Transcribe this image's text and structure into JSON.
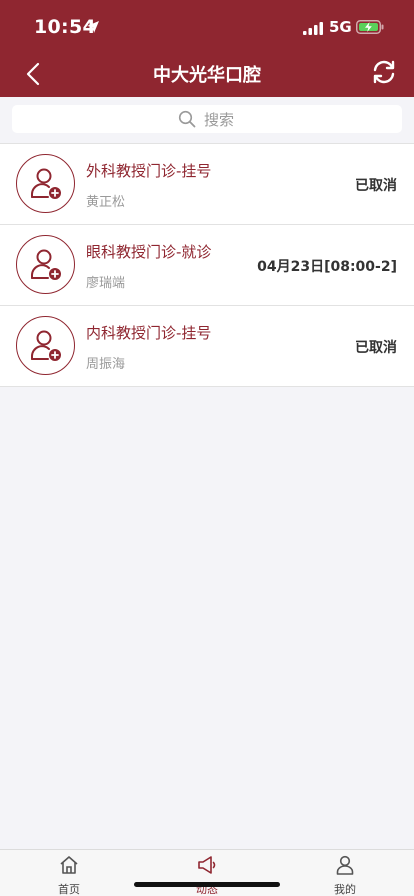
{
  "status_bar": {
    "time": "10:54",
    "network": "5G"
  },
  "header": {
    "title": "中大光华口腔"
  },
  "search": {
    "placeholder": "搜索"
  },
  "appointments": [
    {
      "title": "外科教授门诊-挂号",
      "doctor": "黄正松",
      "status": "已取消"
    },
    {
      "title": "眼科教授门诊-就诊",
      "doctor": "廖瑞端",
      "status": "04月23日[08:00-2]"
    },
    {
      "title": "内科教授门诊-挂号",
      "doctor": "周振海",
      "status": "已取消"
    }
  ],
  "tabs": [
    {
      "label": "首页",
      "icon": "home-icon"
    },
    {
      "label": "动态",
      "icon": "megaphone-icon"
    },
    {
      "label": "我的",
      "icon": "person-icon"
    }
  ],
  "colors": {
    "brand": "#8f2630",
    "background": "#f4f4f8"
  }
}
